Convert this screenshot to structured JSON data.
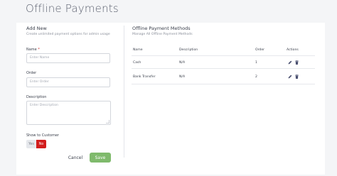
{
  "page": {
    "title": "Offline Payments"
  },
  "form": {
    "title": "Add New",
    "subtitle": "Create unlimited payment options for admin usage",
    "name_label": "Name",
    "name_required": "*",
    "name_placeholder": "Enter Name",
    "order_label": "Order",
    "order_placeholder": "Enter Order",
    "description_label": "Description",
    "description_placeholder": "Enter Description",
    "show_label": "Show to Customer",
    "toggle_yes": "Yes",
    "toggle_no": "No",
    "cancel_label": "Cancel",
    "save_label": "Save"
  },
  "table": {
    "title": "Offline Payment Methods",
    "subtitle": "Manage All Offline Payment Methods",
    "columns": [
      "Name",
      "Description",
      "Order",
      "Actions"
    ],
    "rows": [
      {
        "name": "Cash",
        "description": "N/A",
        "order": "1"
      },
      {
        "name": "Bank Transfer",
        "description": "N/A",
        "order": "2"
      }
    ]
  },
  "colors": {
    "save": "#7fba6c",
    "no_active": "#d21d1d",
    "edit_icon": "#4a5070",
    "delete_icon": "#4a5070"
  },
  "icons": {
    "edit": "pencil-icon",
    "delete": "trash-icon"
  }
}
